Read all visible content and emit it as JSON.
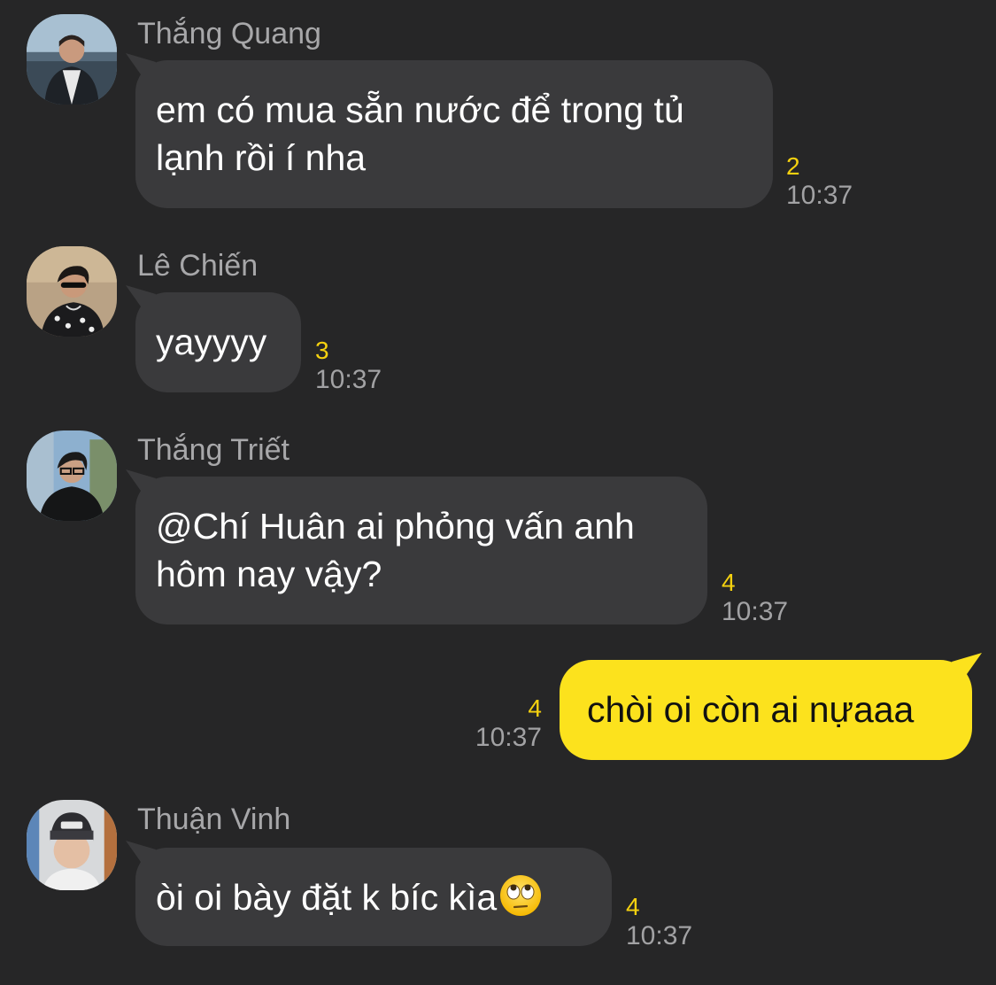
{
  "messages": [
    {
      "sender": "Thắng Quang",
      "lines": [
        "em có mua sẵn nước để trong tủ",
        "lạnh rồi í nha"
      ],
      "read_count": "2",
      "time": "10:37",
      "avatar": "avatar-thang-quang"
    },
    {
      "sender": "Lê Chiến",
      "lines": [
        "yayyyy"
      ],
      "read_count": "3",
      "time": "10:37",
      "avatar": "avatar-le-chien"
    },
    {
      "sender": "Thắng Triết",
      "lines": [
        "@Chí Huân ai phỏng vấn anh",
        "hôm nay vậy?"
      ],
      "read_count": "4",
      "time": "10:37",
      "avatar": "avatar-thang-triet"
    },
    {
      "sender": "",
      "lines": [
        "chòi oi còn ai nựaaa"
      ],
      "read_count": "4",
      "time": "10:37",
      "mine": true
    },
    {
      "sender": "Thuận Vinh",
      "lines": [
        "òi oi bày đặt k bíc kìa"
      ],
      "emoji": "face-with-rolling-eyes-icon",
      "read_count": "4",
      "time": "10:37",
      "avatar": "avatar-thuan-vinh"
    }
  ],
  "colors": {
    "background": "#262627",
    "bubble_other": "#3a3a3c",
    "bubble_mine": "#fce21d",
    "read_count": "#f5d10f",
    "meta_text": "#a2a2a4"
  }
}
